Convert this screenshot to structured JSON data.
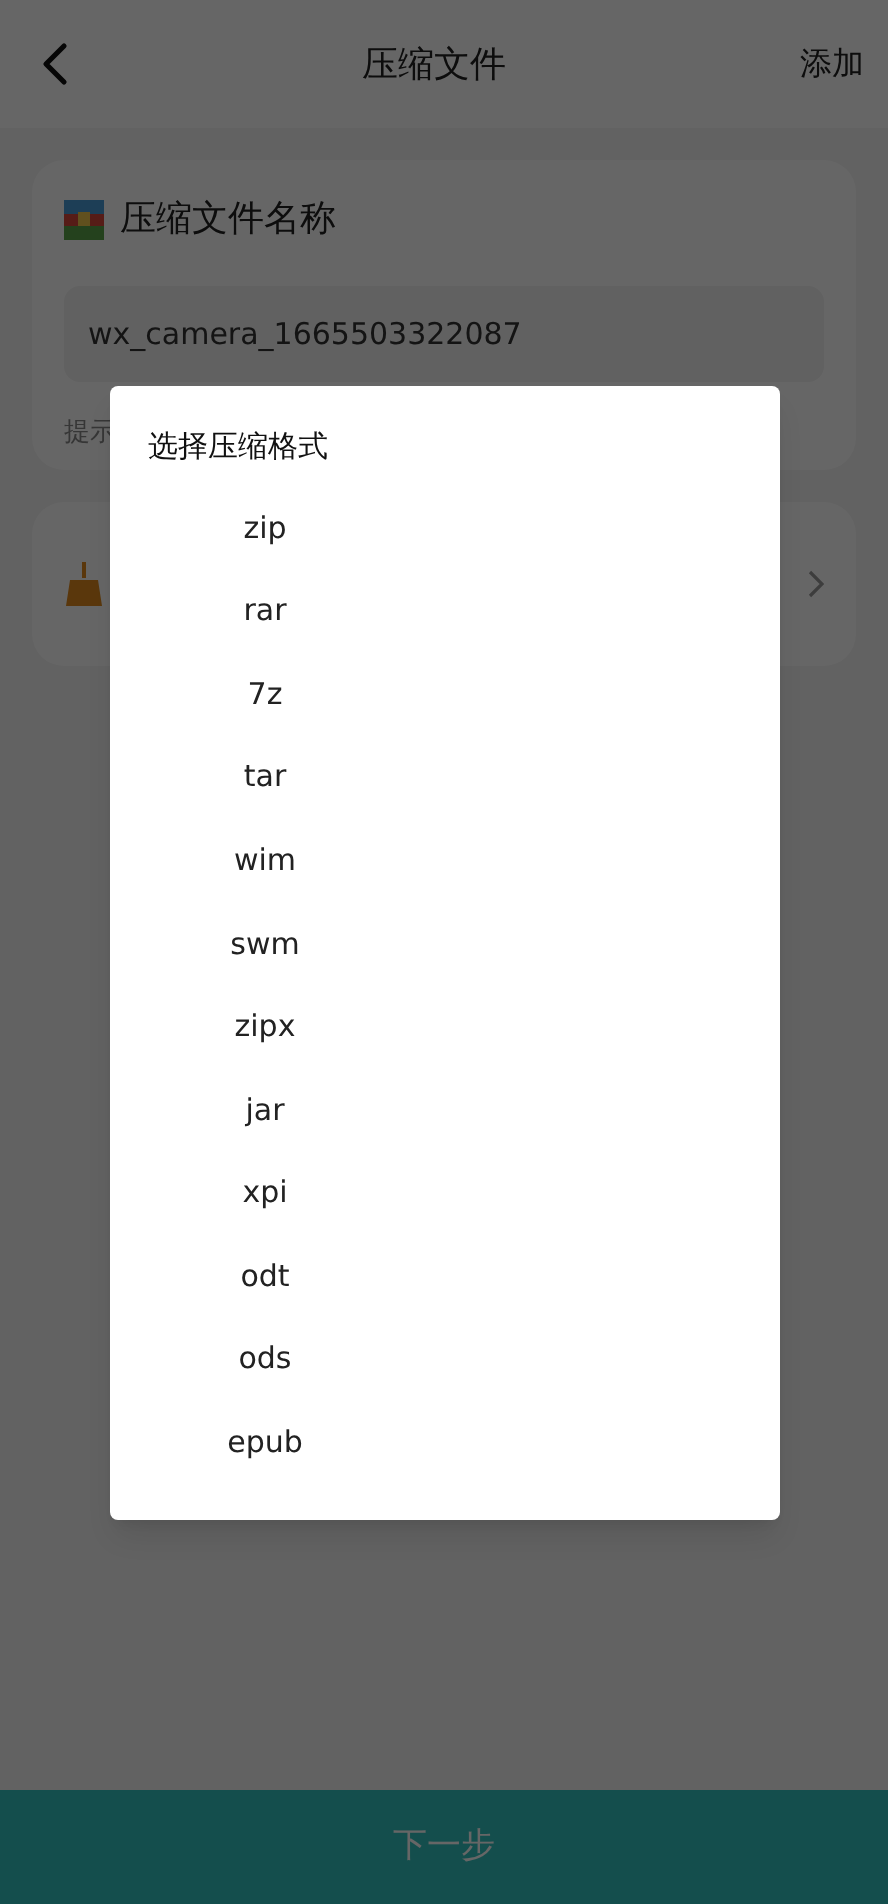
{
  "header": {
    "title": "压缩文件",
    "action": "添加"
  },
  "name_card": {
    "title": "压缩文件名称",
    "value": "wx_camera_1665503322087",
    "hint": "提示"
  },
  "dialog": {
    "title": "选择压缩格式",
    "options": [
      "zip",
      "rar",
      "7z",
      "tar",
      "wim",
      "swm",
      "zipx",
      "jar",
      "xpi",
      "odt",
      "ods",
      "epub"
    ]
  },
  "next_button": {
    "label": "下一步"
  }
}
